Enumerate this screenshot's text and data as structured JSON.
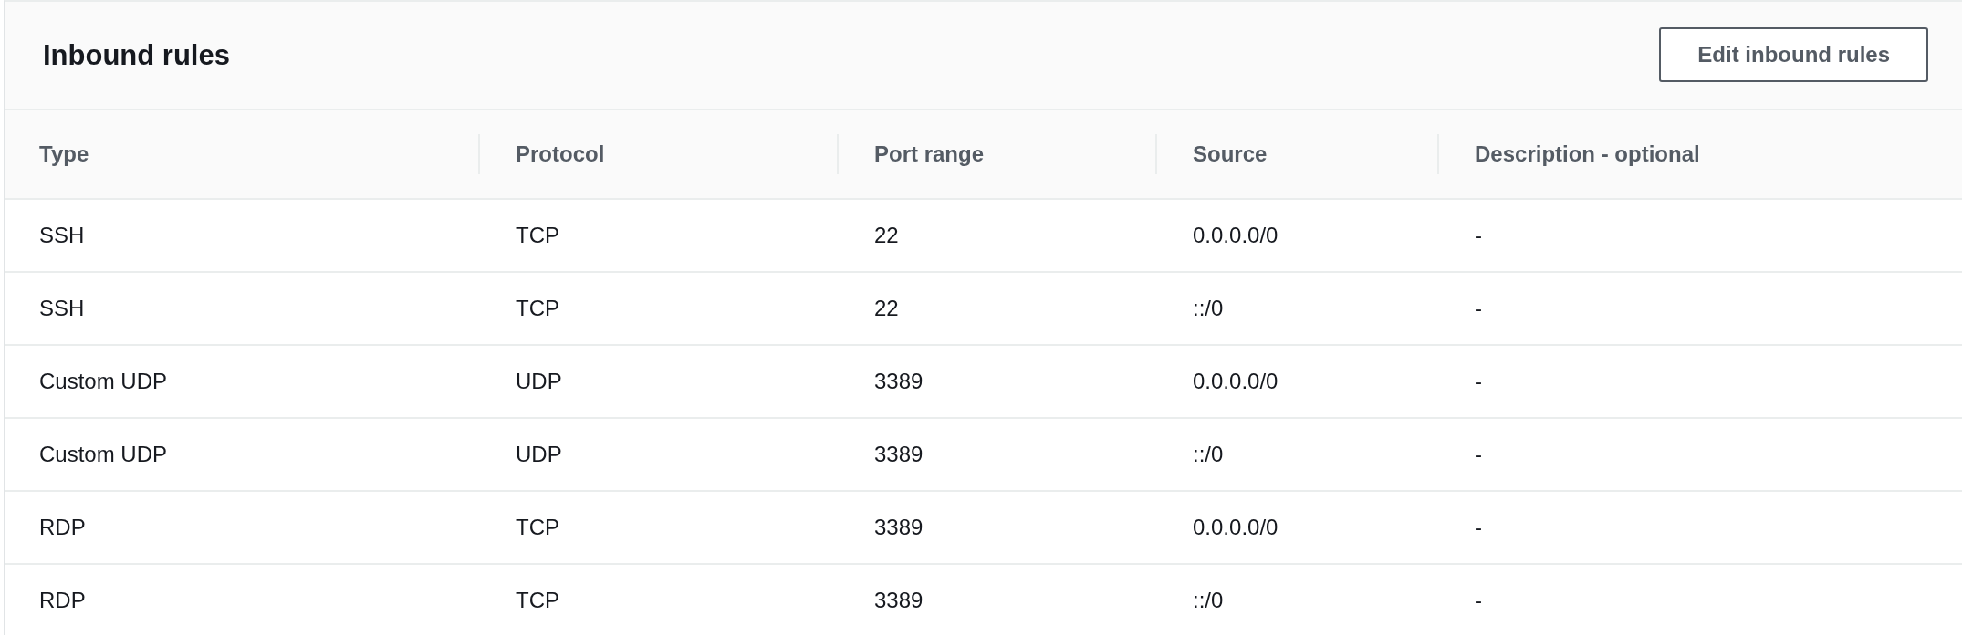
{
  "panel": {
    "title": "Inbound rules",
    "edit_button": "Edit inbound rules"
  },
  "table": {
    "columns": [
      "Type",
      "Protocol",
      "Port range",
      "Source",
      "Description - optional"
    ],
    "rows": [
      [
        "SSH",
        "TCP",
        "22",
        "0.0.0.0/0",
        "-"
      ],
      [
        "SSH",
        "TCP",
        "22",
        "::/0",
        "-"
      ],
      [
        "Custom UDP",
        "UDP",
        "3389",
        "0.0.0.0/0",
        "-"
      ],
      [
        "Custom UDP",
        "UDP",
        "3389",
        "::/0",
        "-"
      ],
      [
        "RDP",
        "TCP",
        "3389",
        "0.0.0.0/0",
        "-"
      ],
      [
        "RDP",
        "TCP",
        "3389",
        "::/0",
        "-"
      ]
    ]
  }
}
